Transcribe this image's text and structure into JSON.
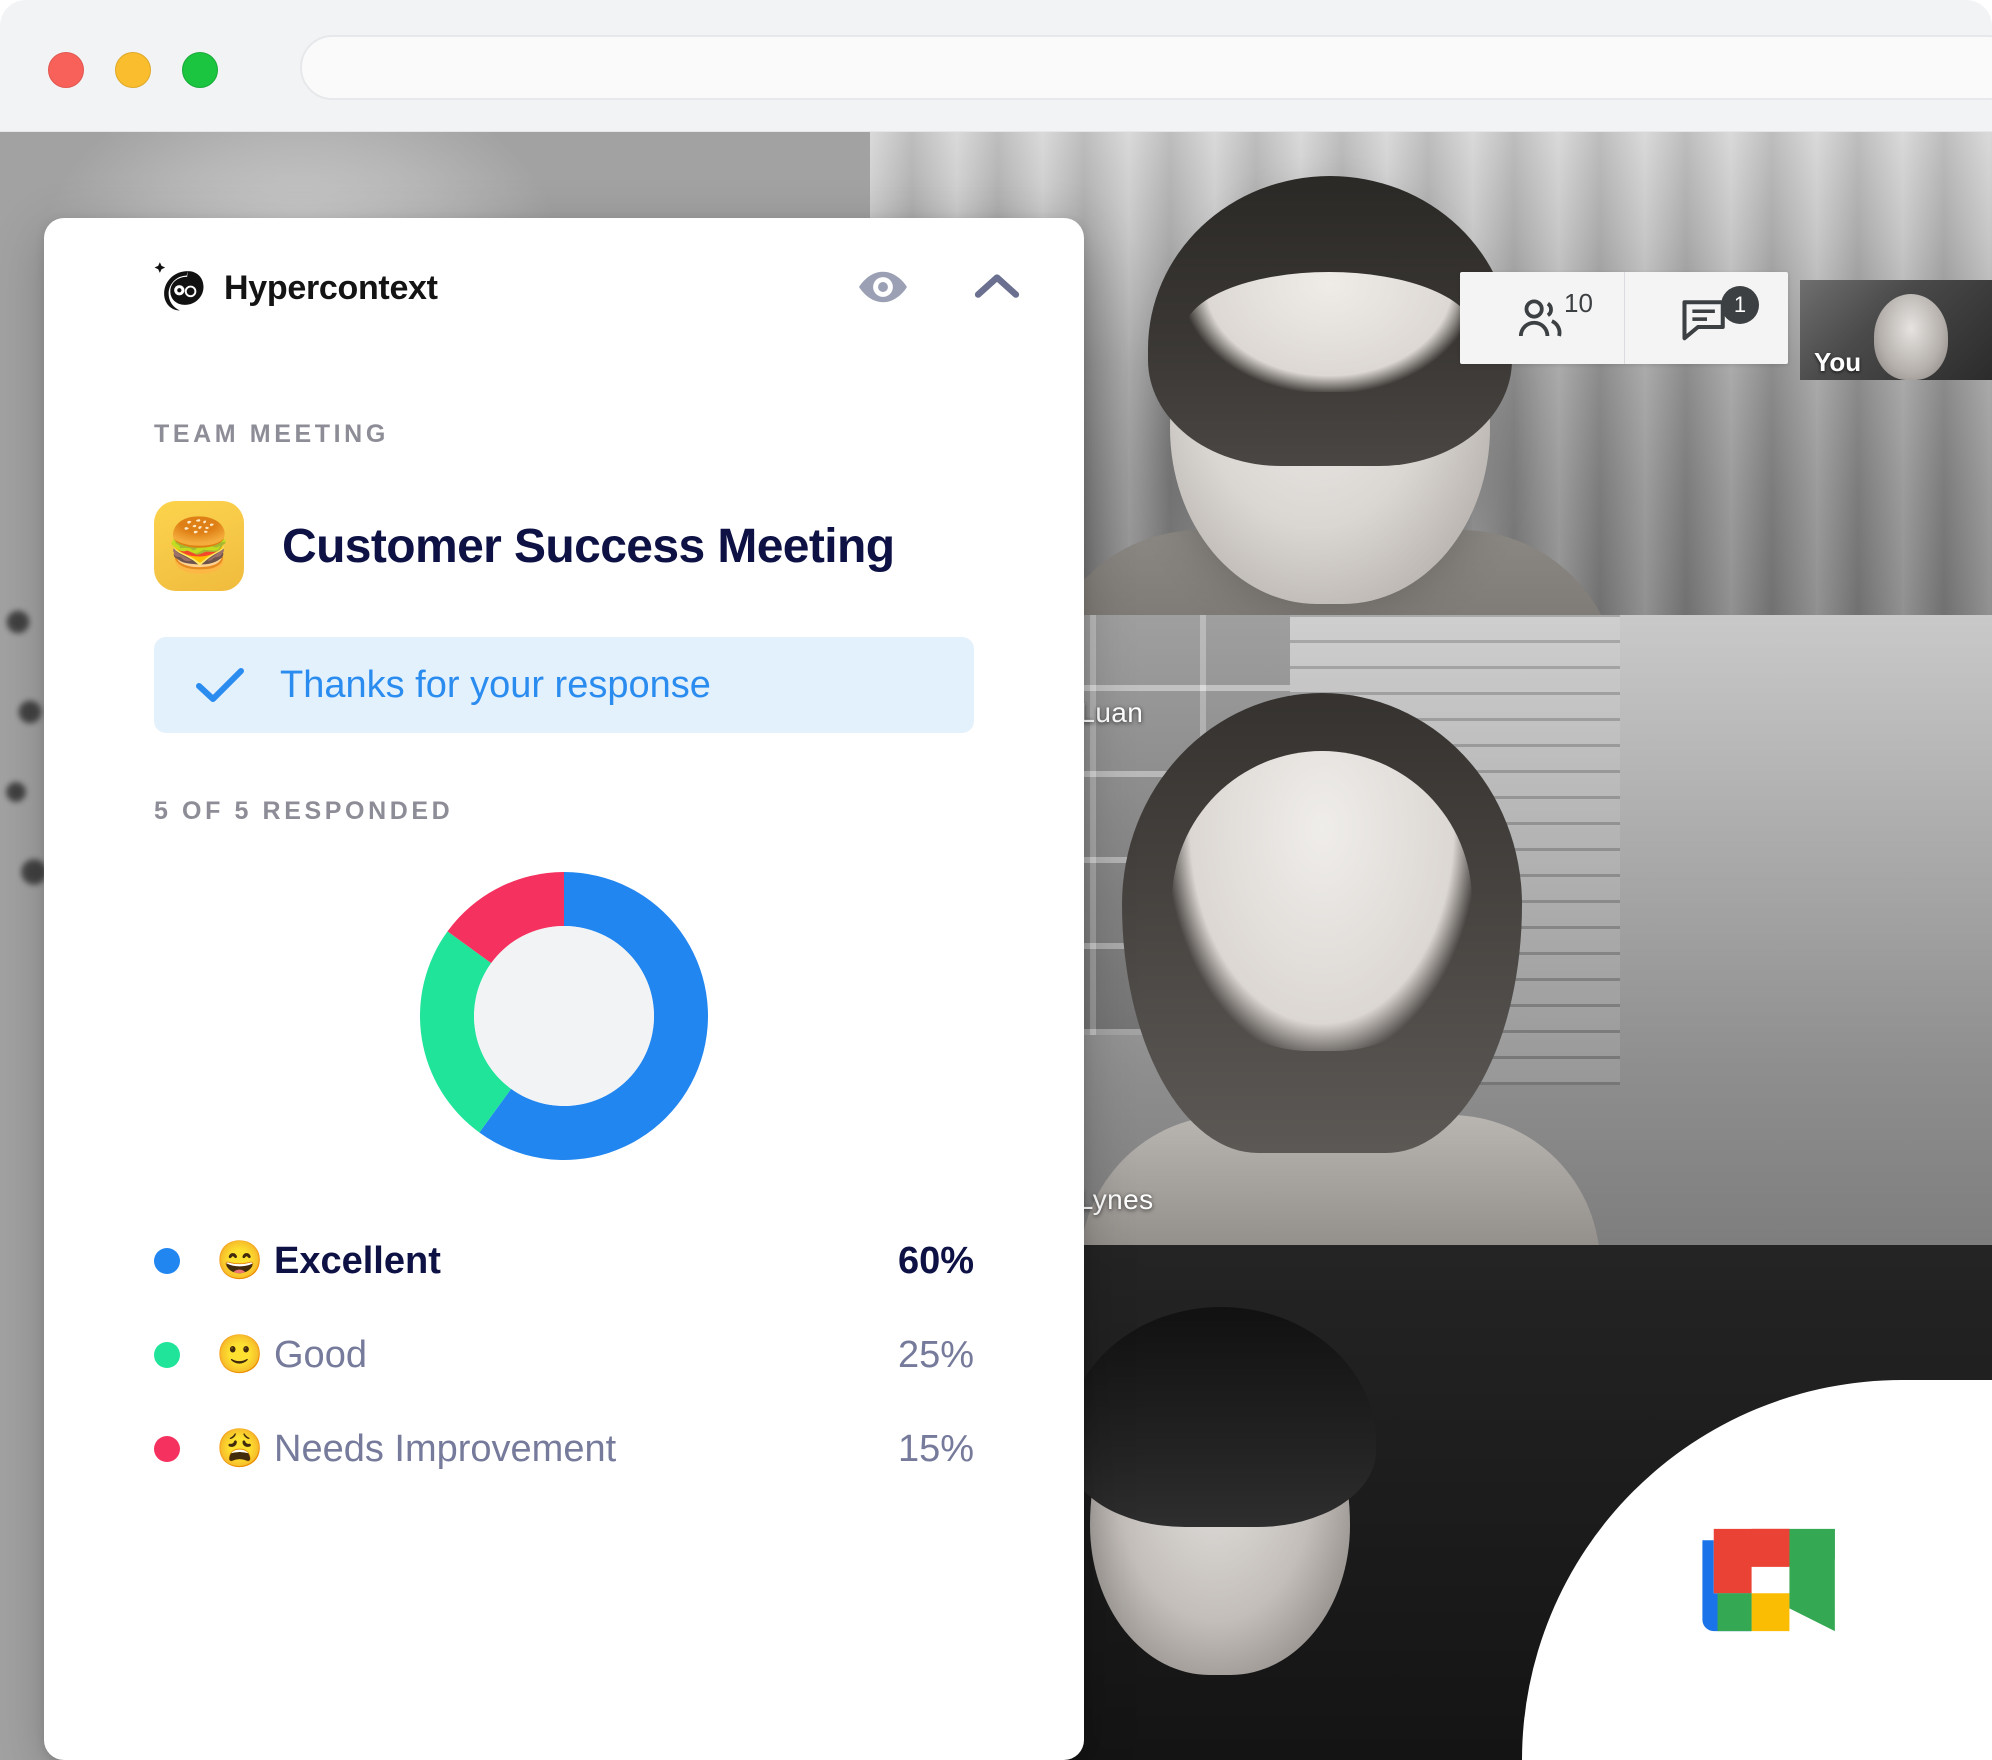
{
  "browser": {
    "traffic_lights": [
      "close",
      "minimize",
      "maximize"
    ],
    "url_value": "",
    "url_placeholder": ""
  },
  "meet": {
    "participants_count": "10",
    "chat_badge": "1",
    "self_label": "You",
    "participants": [
      {
        "name": "Jack Luan"
      },
      {
        "name": "Risa Lynes"
      }
    ],
    "logo_name": "google-meet-logo"
  },
  "panel": {
    "brand": "Hypercontext",
    "actions": [
      {
        "name": "eye-icon",
        "label": "Preview"
      },
      {
        "name": "chevron-up-icon",
        "label": "Collapse"
      }
    ],
    "section_label": "TEAM MEETING",
    "meeting": {
      "emoji": "🍔",
      "title": "Customer Success Meeting"
    },
    "thanks_banner": {
      "icon": "check-icon",
      "text": "Thanks for your response"
    },
    "responded_label": "5 OF 5 RESPONDED"
  },
  "chart_data": {
    "type": "pie",
    "variant": "donut",
    "title": "5 OF 5 RESPONDED",
    "categories": [
      "Excellent",
      "Good",
      "Needs Improvement"
    ],
    "values": [
      60,
      25,
      15
    ],
    "unit": "%",
    "colors": [
      "#2286f0",
      "#20e49a",
      "#f5325f"
    ],
    "emojis": [
      "😄",
      "🙂",
      "😩"
    ],
    "labels": [
      "60%",
      "25%",
      "15%"
    ],
    "inner_color": "#f2f3f5",
    "start_angle": 0,
    "direction": "clockwise",
    "legend": "bottom",
    "legend_entries": [
      {
        "name": "Excellent",
        "value": "60%",
        "color": "#2286f0",
        "emoji": "😄",
        "emphasis": "primary"
      },
      {
        "name": "Good",
        "value": "25%",
        "color": "#20e49a",
        "emoji": "🙂",
        "emphasis": "muted"
      },
      {
        "name": "Needs Improvement",
        "value": "15%",
        "color": "#f5325f",
        "emoji": "😩",
        "emphasis": "muted"
      }
    ]
  }
}
